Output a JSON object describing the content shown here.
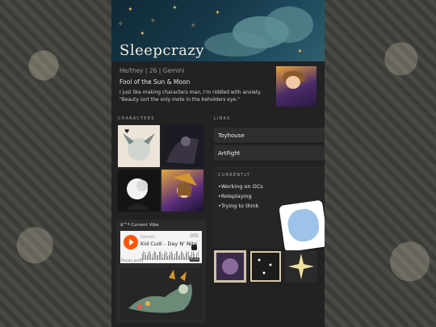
{
  "profile": {
    "name": "Sleepcrazy",
    "pronouns": "He/they | 26 | Gemini",
    "subtitle": "Fool of the Sun & Moon",
    "bio_line1": "I just like making characters man, I'm riddled with anxiety.",
    "bio_line2": "\"Beauty isnt the only mote in the beholders eye.\""
  },
  "sections": {
    "characters": "CHARACTERS",
    "links": "LINKS",
    "currently": "CURRENTLY"
  },
  "links": [
    "Toyhouse",
    "ArtFight"
  ],
  "currently": [
    "•Working on OCs",
    "•Roleplaying",
    "•Trying to think"
  ],
  "vibe": {
    "title": "â™ª Current Vibe",
    "artist": "Gemini",
    "track": "Kid Cudi - Day N' Nite",
    "policy": "Privacy policy",
    "time": "4:22"
  },
  "colors": {
    "page_bg": "#3a3a36",
    "card_bg": "#222222",
    "accent_orange": "#ff5500",
    "banner_star": "#d9b35a"
  }
}
